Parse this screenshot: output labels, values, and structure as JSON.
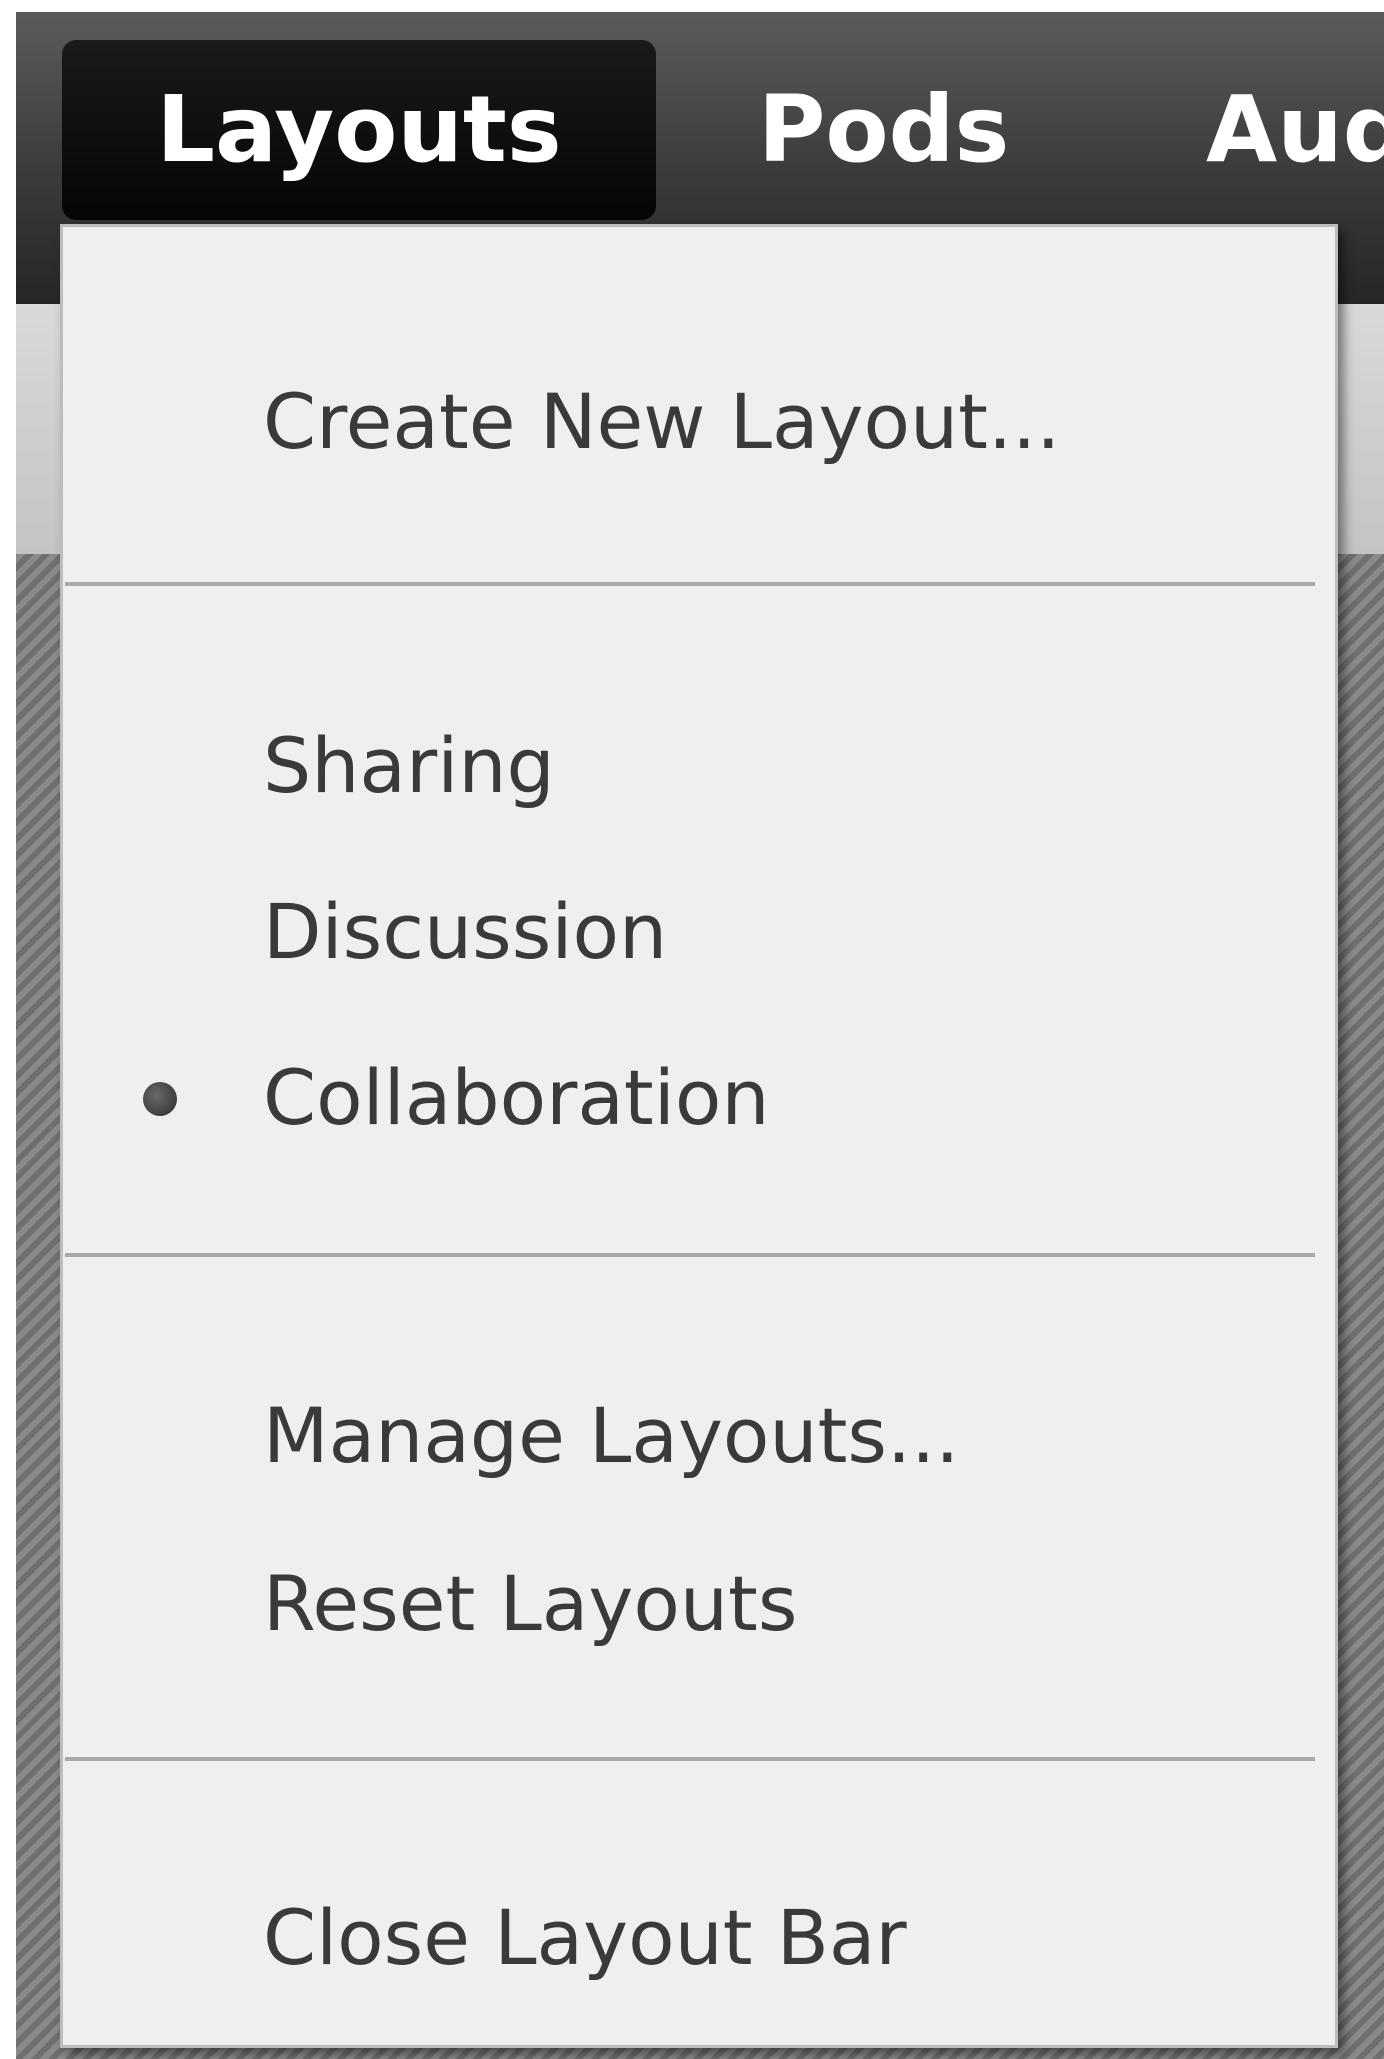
{
  "menubar": {
    "menus": [
      "Layouts",
      "Pods",
      "Aud"
    ],
    "active_menu": "Layouts"
  },
  "dropdown": {
    "groups": [
      {
        "items": [
          {
            "label": "Create New Layout...",
            "selected": false
          }
        ]
      },
      {
        "items": [
          {
            "label": "Sharing",
            "selected": false
          },
          {
            "label": "Discussion",
            "selected": false
          },
          {
            "label": "Collaboration",
            "selected": true
          }
        ]
      },
      {
        "items": [
          {
            "label": "Manage Layouts...",
            "selected": false
          },
          {
            "label": "Reset Layouts",
            "selected": false
          }
        ]
      },
      {
        "items": [
          {
            "label": "Close Layout Bar",
            "selected": false
          }
        ]
      }
    ]
  }
}
